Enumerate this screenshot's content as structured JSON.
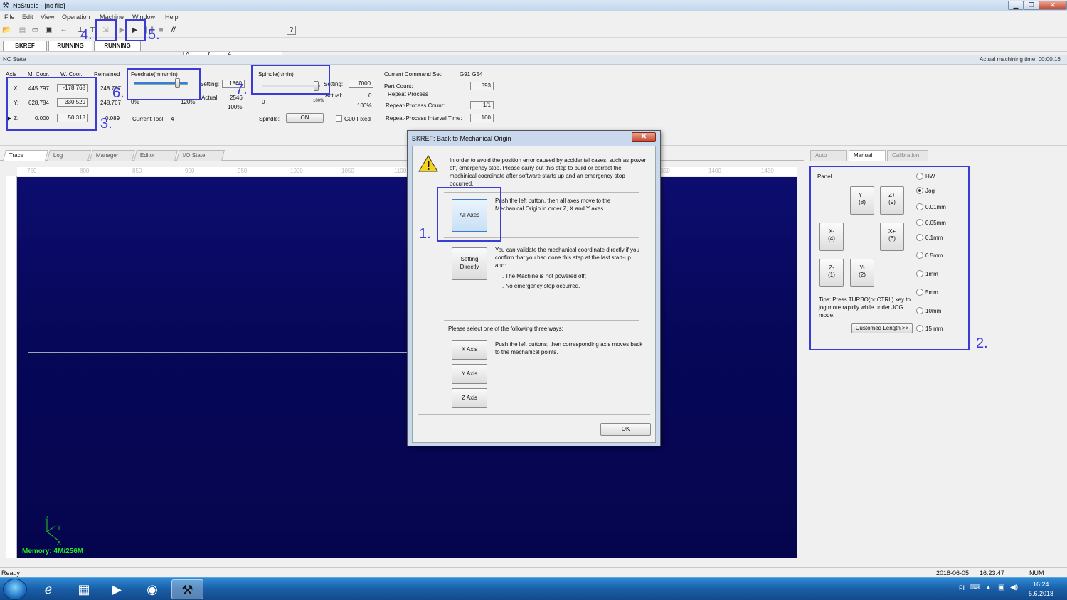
{
  "window": {
    "title": "NcStudio - [no file]",
    "min": "▁",
    "max": "❐",
    "close": "✕"
  },
  "menu": [
    "File",
    "Edit",
    "View",
    "Operation",
    "Machine",
    "Window",
    "Help"
  ],
  "toolbar": {
    "coords": {
      "x": "X",
      "y": "Y",
      "z": "Z"
    }
  },
  "mode_tabs": [
    "BKREF",
    "RUNNING",
    "RUNNING"
  ],
  "nc_state": {
    "label": "NC State",
    "machining_time": "Actual machining time: 00:00:16"
  },
  "axes": {
    "headers": {
      "axis": "Axis",
      "mcoor": "M. Coor.",
      "wcoor": "W. Coor.",
      "remained": "Remained"
    },
    "rows": [
      {
        "axis": "X:",
        "m": "445.797",
        "w": "-178.768",
        "r": "248.767"
      },
      {
        "axis": "Y:",
        "m": "628.784",
        "w": "330.529",
        "r": "248.767"
      },
      {
        "axis": "Z:",
        "m": "0.000",
        "w": "50.318",
        "r": "0.089"
      }
    ]
  },
  "feedrate": {
    "title": "Feedrate(mm/min)",
    "setting_label": "Setting:",
    "setting": "1860",
    "actual_label": "Actual:",
    "actual": "2546",
    "percent": "100%",
    "min": "0%",
    "max": "120%",
    "current_tool_label": "Current Tool:",
    "current_tool": "4"
  },
  "spindle": {
    "title": "Spindle(r/min)",
    "setting_label": "Setting:",
    "setting": "7000",
    "actual_label": "Actual:",
    "actual": "0",
    "percent": "100%",
    "min": "0",
    "max": "100%",
    "spindle_label": "Spindle:",
    "on": "ON",
    "g00": "G00 Fixed"
  },
  "commands": {
    "set_label": "Current Command Set:",
    "set": "G91 G54",
    "part_count_label": "Part Count:",
    "part_count": "393",
    "repeat": "Repeat Process",
    "repeat_count_label": "Repeat-Process Count:",
    "repeat_count": "1/1",
    "interval_label": "Repeat-Process Interval Time:",
    "interval": "100"
  },
  "view_tabs": [
    "Trace",
    "Log",
    "Manager",
    "Editor",
    "I/O State"
  ],
  "ruler_ticks": [
    "750",
    "800",
    "850",
    "900",
    "950",
    "1000",
    "1050",
    "1100",
    "1150",
    "1200",
    "1250",
    "1300",
    "1350",
    "1400",
    "1450"
  ],
  "memory": "Memory: 4M/256M",
  "axis_labels": {
    "x": "X",
    "y": "Y",
    "z": "Z"
  },
  "right": {
    "tabs": [
      "Auto",
      "Manual",
      "Calibration"
    ],
    "panel": "Panel",
    "jog": {
      "yplus": "Y+",
      "yplus_k": "(8)",
      "zplus": "Z+",
      "zplus_k": "(9)",
      "xminus": "X-",
      "xminus_k": "(4)",
      "xplus": "X+",
      "xplus_k": "(6)",
      "zminus": "Z-",
      "zminus_k": "(1)",
      "yminus": "Y-",
      "yminus_k": "(2)"
    },
    "tips": "Tips: Press TURBO(or CTRL) key to jog more rapidly while under JOG mode.",
    "custom": "Customed Length  >>",
    "radios": [
      "HW",
      "Jog",
      "0.01mm",
      "0.05mm",
      "0.1mm",
      "0.5mm",
      "1mm",
      "5mm",
      "10mm",
      "15  mm"
    ]
  },
  "dialog": {
    "title": "BKREF: Back to Mechanical Origin",
    "intro": "In order to avoid the position error caused by accidental cases, such as power off, emergency stop. Please carry out this step to build or correct the mechinical coordinate after software starts up and an emergency stop occurred.",
    "all_axes": "All Axes",
    "all_axes_desc": "Push the left button, then all axes move to the Mechanical Origin in order Z, X and Y axes.",
    "setting_directly": "Setting Directly",
    "setting_desc": "You can validate the mechanical coordinate directly if you confirm that you had done this step at the last start-up and:",
    "cond1": ". The Machine is not powered off;",
    "cond2": ". No emergency stop occurred.",
    "select_label": "Please select one of the following three ways:",
    "x_axis": "X Axis",
    "y_axis": "Y Axis",
    "z_axis": "Z Axis",
    "axis_desc": "Push the left buttons, then corresponding axis moves back to the mechanical points.",
    "ok": "OK"
  },
  "annotations": [
    "1.",
    "2.",
    "3.",
    "4.",
    "5.",
    "6.",
    "7."
  ],
  "status": {
    "ready": "Ready",
    "date": "2018-06-05",
    "time": "16:23:47",
    "num": "NUM"
  },
  "taskbar": {
    "lang": "FI",
    "clock_time": "16:24",
    "clock_date": "5.6.2018"
  }
}
